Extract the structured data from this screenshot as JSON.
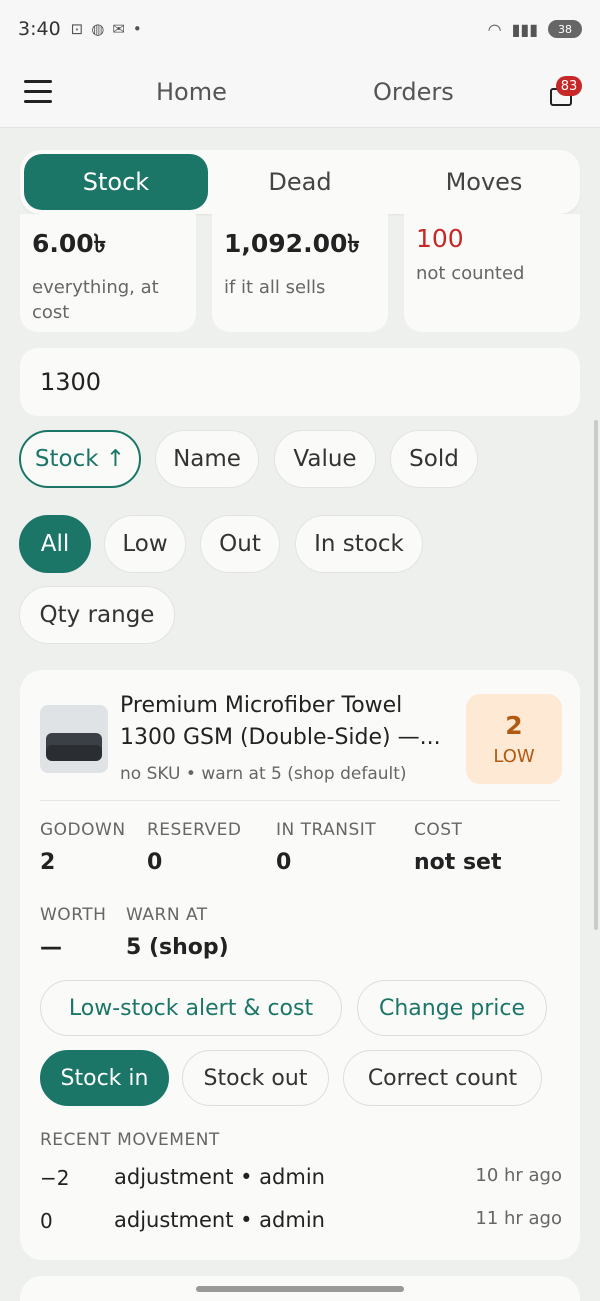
{
  "status_bar": {
    "time": "3:40",
    "battery": "38"
  },
  "nav": {
    "home": "Home",
    "orders": "Orders",
    "notification_count": "83"
  },
  "tabs": [
    "Stock",
    "Dead",
    "Moves"
  ],
  "stats": [
    {
      "value": "6.00৳",
      "label": "everything, at cost"
    },
    {
      "value": "1,092.00৳",
      "label": "if it all sells"
    },
    {
      "value": "100",
      "label": "not counted"
    }
  ],
  "search": {
    "value": "1300"
  },
  "sort_chips": [
    "Stock ↑",
    "Name",
    "Value",
    "Sold"
  ],
  "filter_chips": [
    "All",
    "Low",
    "Out",
    "In stock"
  ],
  "qty_range": "Qty range",
  "product": {
    "title": "Premium Microfiber Towel 1300 GSM (Double-Side) —...",
    "meta": "no SKU  •  warn at 5 (shop default)",
    "badge_qty": "2",
    "badge_label": "LOW",
    "fields": [
      {
        "label": "GODOWN",
        "value": "2"
      },
      {
        "label": "RESERVED",
        "value": "0"
      },
      {
        "label": "IN TRANSIT",
        "value": "0"
      },
      {
        "label": "COST",
        "value": "not set"
      },
      {
        "label": "WORTH",
        "value": "—"
      },
      {
        "label": "WARN AT",
        "value": "5 (shop)"
      }
    ],
    "actions": {
      "low_stock_alert": "Low-stock alert & cost",
      "change_price": "Change price",
      "stock_in": "Stock in",
      "stock_out": "Stock out",
      "correct_count": "Correct count"
    },
    "recent_heading": "RECENT MOVEMENT",
    "movements": [
      {
        "qty": "−2",
        "desc": "adjustment • admin",
        "time": "10 hr ago"
      },
      {
        "qty": "0",
        "desc": "adjustment • admin",
        "time": "11 hr ago"
      }
    ]
  },
  "colors": {
    "accent": "#1b7667",
    "danger": "#c62828",
    "low_badge_bg": "#fde9d4",
    "low_badge_text": "#b25a12"
  }
}
